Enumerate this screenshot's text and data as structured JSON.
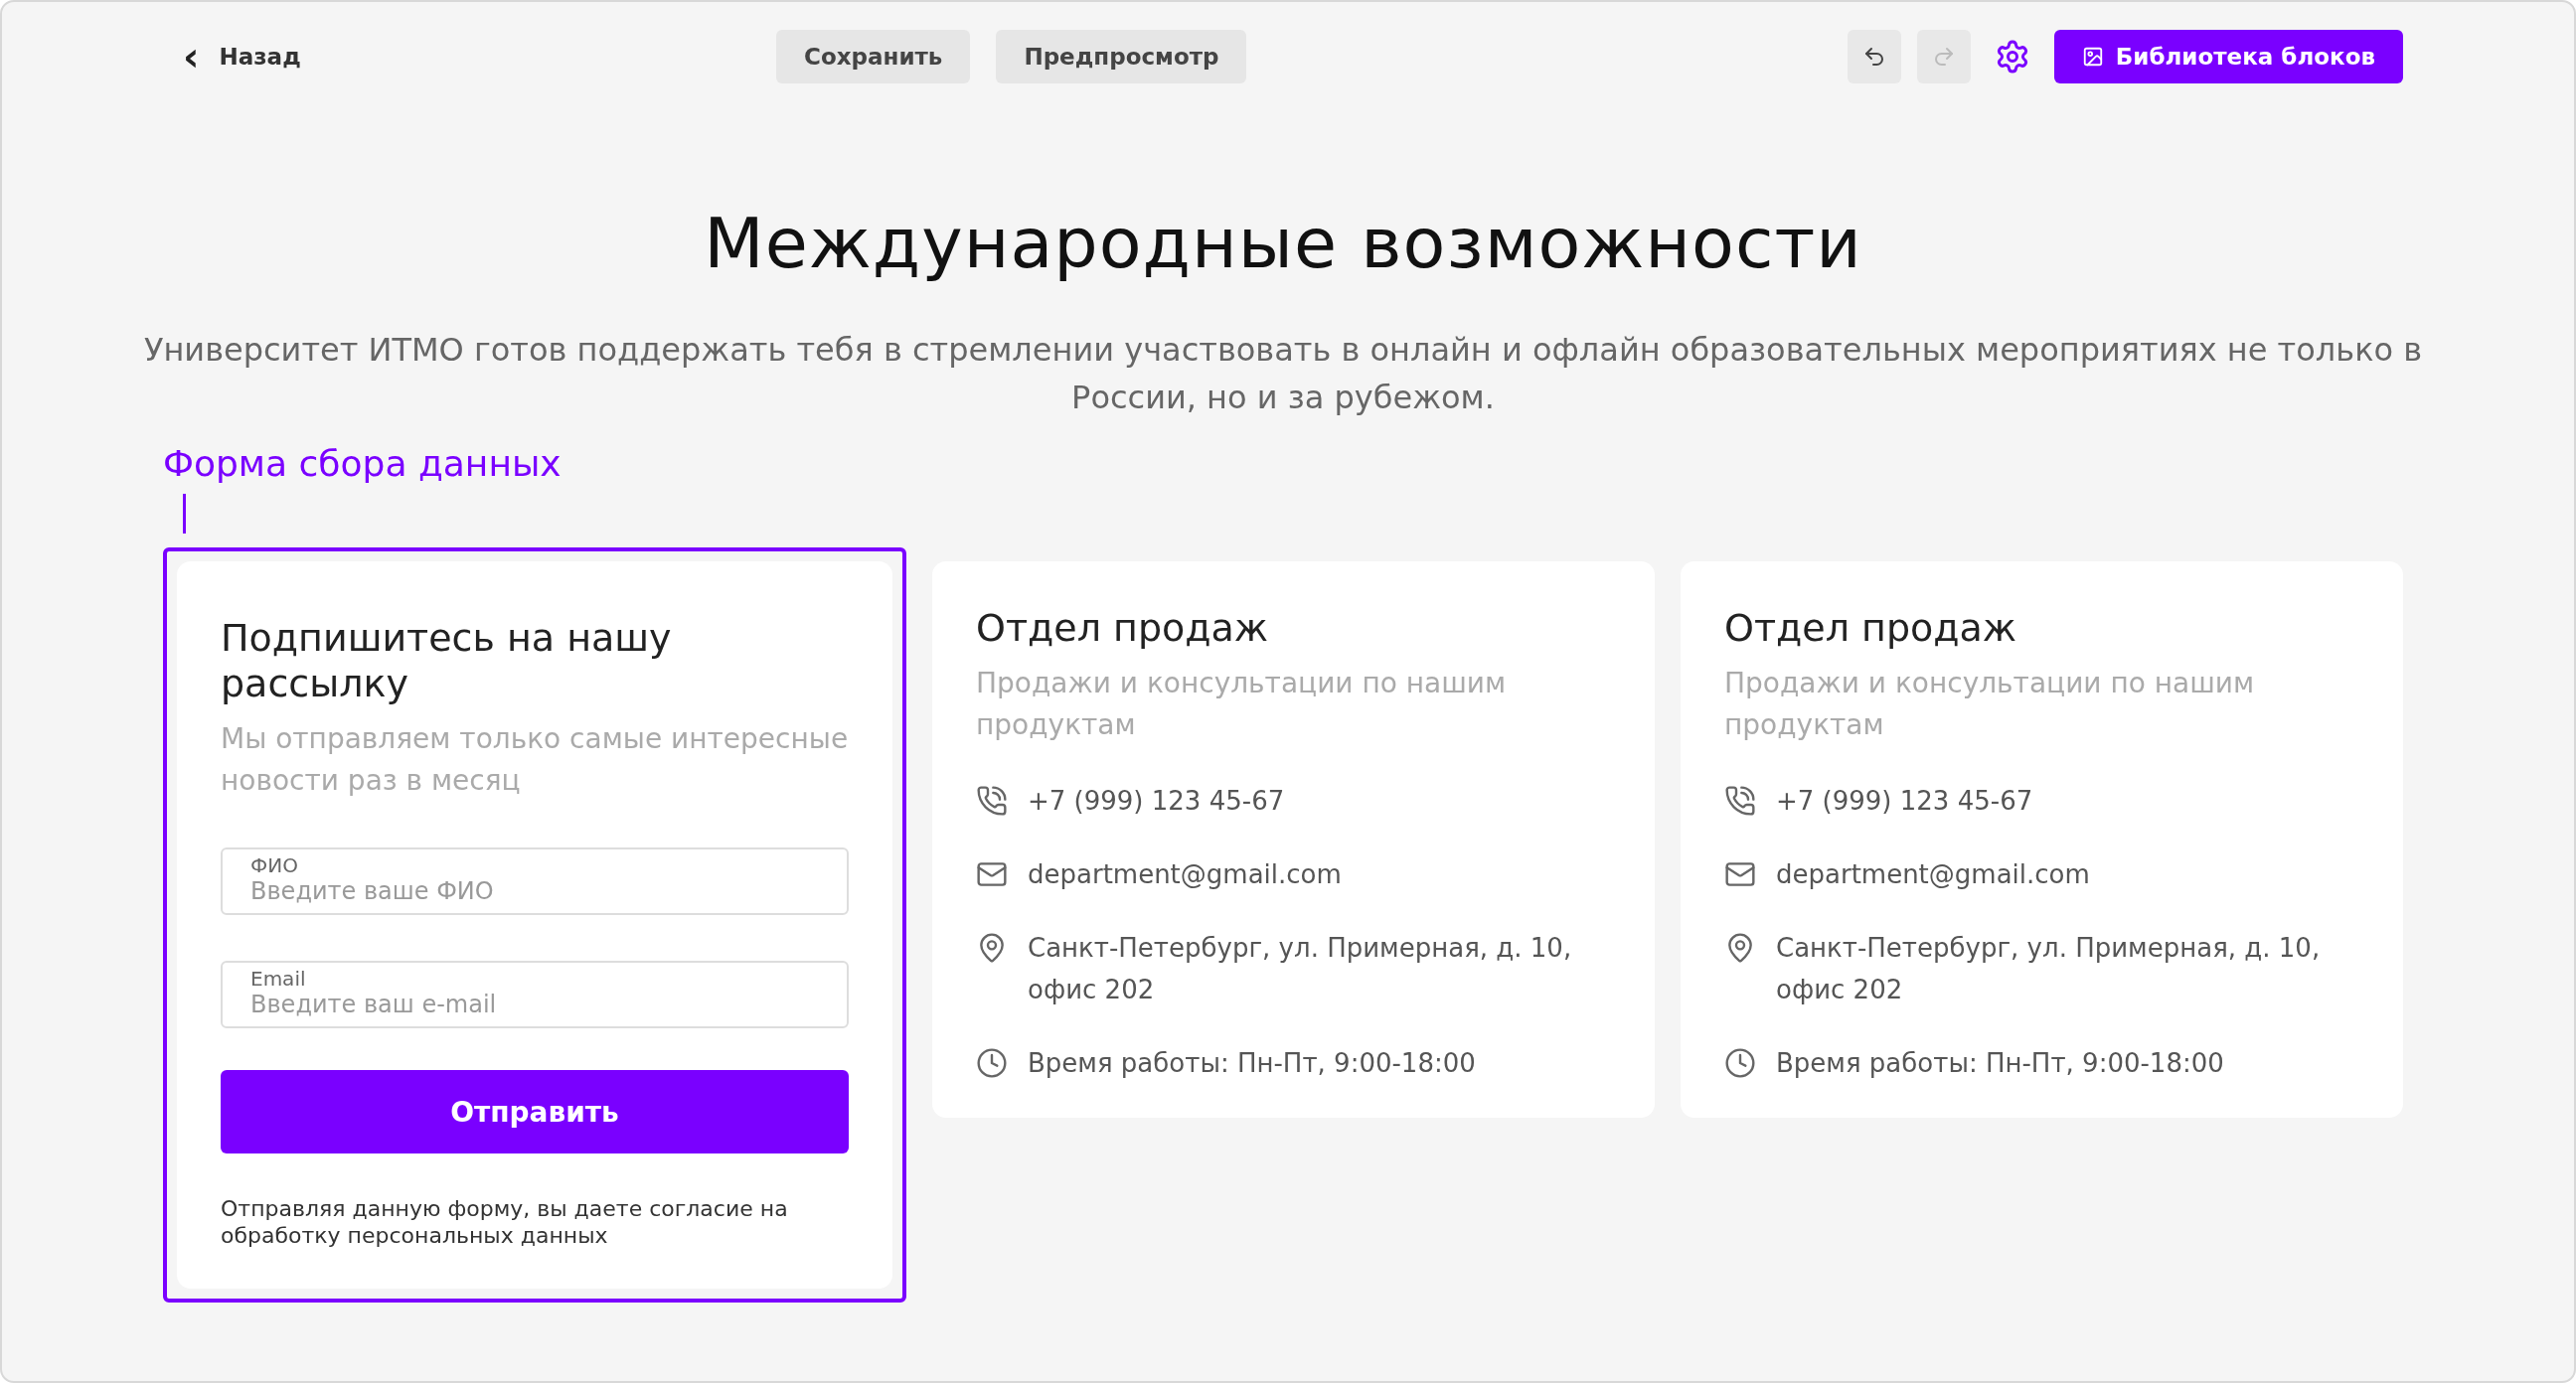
{
  "toolbar": {
    "back": {
      "icon": "‹",
      "label": "Назад"
    },
    "actions": [
      {
        "label": "Сохранить"
      },
      {
        "label": "Предпросмотр"
      }
    ],
    "undo": {
      "disabled": false
    },
    "redo": {
      "disabled": true
    },
    "library": {
      "label": "Библиотека блоков"
    }
  },
  "page": {
    "title": "Международные возможности",
    "subtitle": "Университет ИТМО готов поддержать тебя в стремлении участвовать в онлайн и офлайн образовательных мероприятиях не только в России, но и за рубежом."
  },
  "selection": {
    "label": "Форма сбора данных"
  },
  "form": {
    "selected": true,
    "title": "Подпишитесь на нашу рассылку",
    "description": "Мы отправляем только самые интересные новости раз в месяц",
    "fields": [
      {
        "label": "ФИО",
        "placeholder": "Введите ваше ФИО"
      },
      {
        "label": "Email",
        "placeholder": "Введите ваш e-mail"
      }
    ],
    "submit": "Отправить",
    "consent": "Отправляя данную форму, вы даете согласие на обработку персональных данных"
  },
  "contacts": [
    {
      "title": "Отдел продаж",
      "description": "Продажи и консультации по нашим продуктам",
      "items": [
        {
          "kind": "phone",
          "text": "+7 (999) 123 45-67"
        },
        {
          "kind": "email",
          "text": "department@gmail.com"
        },
        {
          "kind": "address",
          "text": "Санкт-Петербург, ул. Примерная, д. 10, офис 202"
        },
        {
          "kind": "hours",
          "text": "Время работы: Пн-Пт, 9:00-18:00"
        }
      ]
    },
    {
      "title": "Отдел продаж",
      "description": "Продажи и консультации по нашим продуктам",
      "items": [
        {
          "kind": "phone",
          "text": "+7 (999) 123 45-67"
        },
        {
          "kind": "email",
          "text": "department@gmail.com"
        },
        {
          "kind": "address",
          "text": "Санкт-Петербург, ул. Примерная, д. 10, офис 202"
        },
        {
          "kind": "hours",
          "text": "Время работы: Пн-Пт, 9:00-18:00"
        }
      ]
    }
  ]
}
